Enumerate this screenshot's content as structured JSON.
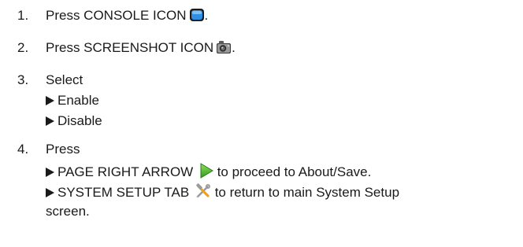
{
  "steps": [
    {
      "number": "1.",
      "text": "Press CONSOLE ICON",
      "icon": "console-icon",
      "suffix": "."
    },
    {
      "number": "2.",
      "text": "Press SCREENSHOT ICON",
      "icon": "camera-icon",
      "suffix": "."
    },
    {
      "number": "3.",
      "text": "Select",
      "options": [
        "Enable",
        "Disable"
      ]
    },
    {
      "number": "4.",
      "text": "Press",
      "options": [
        {
          "label": "PAGE RIGHT ARROW",
          "icon": "page-right-arrow-icon",
          "after": "to proceed to About/Save."
        },
        {
          "label": "SYSTEM SETUP TAB",
          "icon": "system-setup-tools-icon",
          "after": "to return to main System Setup",
          "continuation": "screen."
        }
      ]
    }
  ],
  "colors": {
    "text": "#1a1a1a",
    "console_blue": "#2f8fe0",
    "arrow_green": "#5cc23a",
    "tool_orange": "#f0a020"
  }
}
